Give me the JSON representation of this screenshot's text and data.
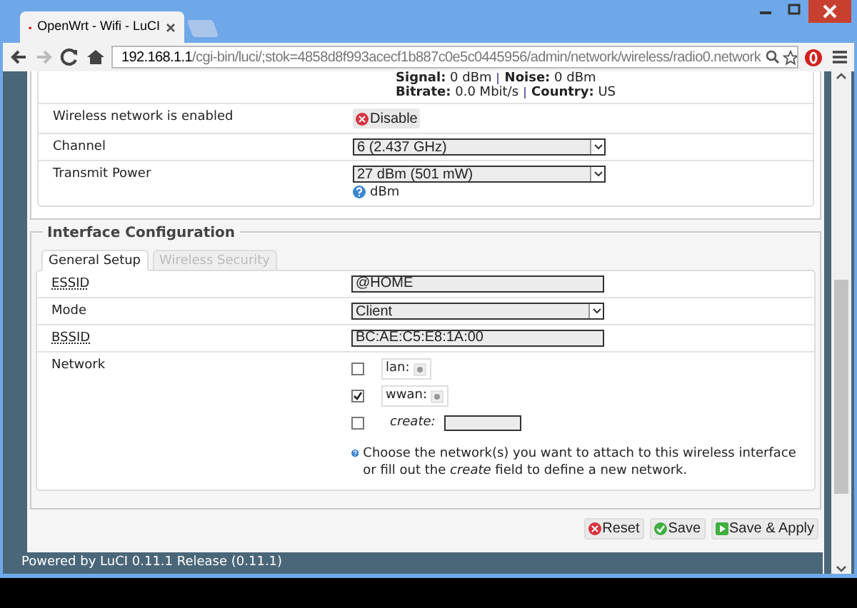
{
  "browser": {
    "tabs": [
      {
        "title": "OpenWrt - Wifi - LuCI",
        "selected": true
      }
    ],
    "address": {
      "host": "192.168.1.1",
      "path": "/cgi-bin/luci/;stok=4858d8f993acecf1b887c0e5c0445956/admin/network/wireless/radio0.network"
    }
  },
  "status": [
    [
      {
        "label": "Signal:",
        "value": "0 dBm"
      },
      {
        "label": "Noise:",
        "value": "0 dBm"
      }
    ],
    [
      {
        "label": "Bitrate:",
        "value": "0.0 Mbit/s"
      },
      {
        "label": "Country:",
        "value": "US"
      }
    ]
  ],
  "device_rows": [
    {
      "label": "Wireless network is enabled",
      "kind": "button",
      "value": "Disable"
    },
    {
      "label": "Channel",
      "kind": "select",
      "value": "6 (2.437 GHz)"
    },
    {
      "label": "Transmit Power",
      "kind": "select",
      "value": "27 dBm (501 mW)",
      "help": "dBm"
    }
  ],
  "interface": {
    "legend": "Interface Configuration",
    "tabs": [
      {
        "label": "General Setup",
        "selected": true
      },
      {
        "label": "Wireless Security",
        "selected": false
      }
    ],
    "rows": [
      {
        "label": "ESSID",
        "hint": true,
        "kind": "input",
        "value": "@HOME"
      },
      {
        "label": "Mode",
        "hint": false,
        "kind": "select",
        "value": "Client"
      },
      {
        "label": "BSSID",
        "hint": true,
        "kind": "input",
        "value": "BC:AE:C5:E8:1A:00"
      },
      {
        "label": "Network",
        "hint": false,
        "kind": "networks",
        "options": [
          {
            "label": "lan:",
            "kind": "network",
            "checked": false
          },
          {
            "label": "wwan:",
            "kind": "network",
            "checked": true
          },
          {
            "label": "create:",
            "kind": "create",
            "checked": false
          }
        ],
        "help": "Choose the network(s) you want to attach to this wireless interface or fill out the *create* field to define a new network."
      }
    ]
  },
  "actions": [
    {
      "label": "Reset",
      "kind": "reset"
    },
    {
      "label": "Save",
      "kind": "save"
    },
    {
      "label": "Save & Apply",
      "kind": "apply"
    }
  ],
  "footer": "Powered by LuCI 0.11.1 Release (0.11.1)"
}
